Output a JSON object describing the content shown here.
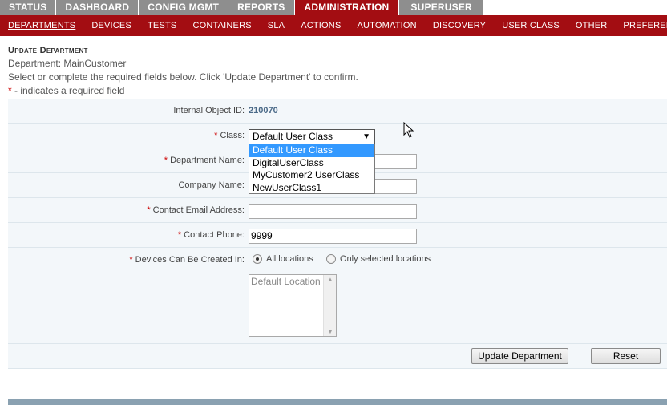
{
  "top_tabs": [
    {
      "label": "STATUS",
      "active": false
    },
    {
      "label": "DASHBOARD",
      "active": false
    },
    {
      "label": "CONFIG MGMT",
      "active": false
    },
    {
      "label": "REPORTS",
      "active": false
    },
    {
      "label": "ADMINISTRATION",
      "active": true
    },
    {
      "label": "SUPERUSER",
      "active": false
    }
  ],
  "sub_nav": [
    {
      "label": "DEPARTMENTS",
      "active": true
    },
    {
      "label": "DEVICES",
      "active": false
    },
    {
      "label": "TESTS",
      "active": false
    },
    {
      "label": "CONTAINERS",
      "active": false
    },
    {
      "label": "SLA",
      "active": false
    },
    {
      "label": "ACTIONS",
      "active": false
    },
    {
      "label": "AUTOMATION",
      "active": false
    },
    {
      "label": "DISCOVERY",
      "active": false
    },
    {
      "label": "USER CLASS",
      "active": false
    },
    {
      "label": "OTHER",
      "active": false
    },
    {
      "label": "PREFERENCES",
      "active": false
    }
  ],
  "header": {
    "title": "Update Department",
    "department_line": "Department: MainCustomer",
    "instructions": "Select or complete the required fields below. Click 'Update Department' to confirm.",
    "required_star": "*",
    "required_note": " - indicates a required field"
  },
  "form": {
    "internal_id_label": "Internal Object ID:",
    "internal_id_value": "210070",
    "class_label": "Class:",
    "class_selected": "Default User Class",
    "class_arrow": "▼",
    "class_options": [
      "Default User Class",
      "DigitalUserClass",
      "MyCustomer2 UserClass",
      "NewUserClass1"
    ],
    "dept_name_label": "Department Name:",
    "dept_name_value": "",
    "company_name_label": "Company Name:",
    "company_name_value": "",
    "email_label": "Contact Email Address:",
    "email_value": "",
    "phone_label": "Contact Phone:",
    "phone_value": "9999",
    "devices_label": "Devices Can Be Created In:",
    "radio_all": "All locations",
    "radio_selected_only": "Only selected locations",
    "location_list": [
      "Default Location"
    ],
    "update_button": "Update Department",
    "reset_button": "Reset"
  },
  "colors": {
    "active_tab": "#a30d12",
    "tab_gray": "#8e8e8e",
    "row_bg": "#f3f7fa",
    "selection": "#3399ff"
  }
}
